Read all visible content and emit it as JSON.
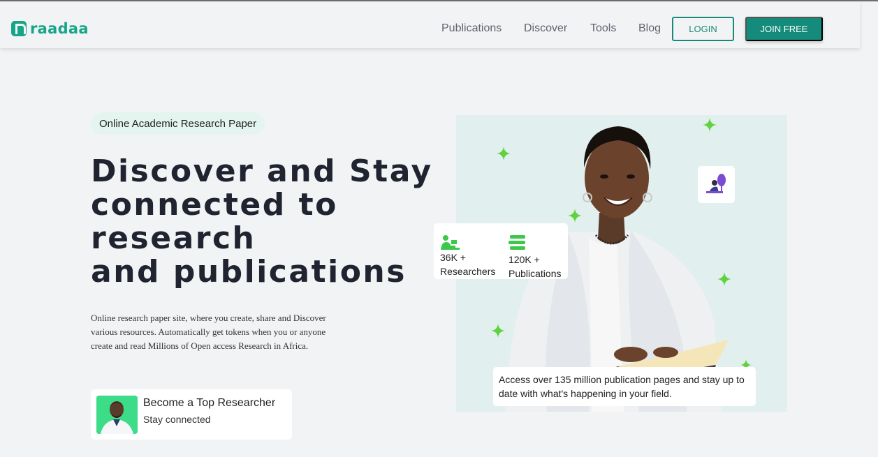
{
  "brand": {
    "name": "raadaa",
    "color": "#17a589"
  },
  "nav": {
    "links": [
      "Publications",
      "Discover",
      "Tools",
      "Blog"
    ],
    "login_label": "LOGIN",
    "join_label": "JOIN FREE"
  },
  "hero": {
    "tag": "Online Academic Research Paper",
    "headline": [
      "Discover and Stay",
      "connected to",
      "research",
      "and publications"
    ],
    "description": "Online research paper site, where you create, share and Discover various resources. Automatically get tokens when you or anyone create and read Millions of Open access Research in Africa.",
    "badge": {
      "title": "Become a Top Researcher",
      "subtitle": "Stay connected"
    }
  },
  "stats": {
    "researchers": {
      "value": "36K +",
      "label": "Researchers",
      "icon": "researcher-icon"
    },
    "publications": {
      "value": "120K +",
      "label": "Publications",
      "icon": "books-icon"
    }
  },
  "info_card": "Access over 135 million publication pages and stay up to date with what's happening in your field.",
  "colors": {
    "accent": "#158b7b",
    "sparkle": "#5fd23c",
    "hero_bg": "#e1efef"
  }
}
